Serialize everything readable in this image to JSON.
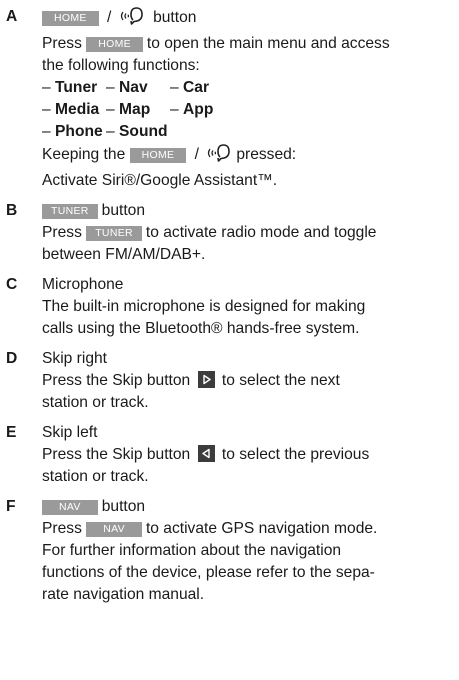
{
  "entries": {
    "A": {
      "letter": "A",
      "home_key": "HOME",
      "slash": "/",
      "title_suffix": "button",
      "line1_pre": "Press",
      "line1_post": "to open the main menu and access",
      "line2": "the following functions:",
      "functions": [
        {
          "dash": "–",
          "name": "Tuner"
        },
        {
          "dash": "–",
          "name": "Nav"
        },
        {
          "dash": "–",
          "name": "Car"
        },
        {
          "dash": "–",
          "name": "Media"
        },
        {
          "dash": "–",
          "name": "Map"
        },
        {
          "dash": "–",
          "name": "App"
        },
        {
          "dash": "–",
          "name": "Phone"
        },
        {
          "dash": "–",
          "name": "Sound"
        }
      ],
      "keeping_pre": "Keeping the",
      "keeping_post": "pressed:",
      "activate": "Activate Siri®/Google Assistant™."
    },
    "B": {
      "letter": "B",
      "key": "TUNER",
      "title_suffix": "button",
      "line1_pre": "Press",
      "line1_post": "to activate radio mode and toggle",
      "line2": "between FM/AM/DAB+."
    },
    "C": {
      "letter": "C",
      "title": "Microphone",
      "line1": "The built-in microphone is designed for making",
      "line2": "calls using the Bluetooth® hands-free system."
    },
    "D": {
      "letter": "D",
      "title": "Skip right",
      "line1_pre": "Press the Skip button",
      "line1_post": "to select the next",
      "line2": "station or track."
    },
    "E": {
      "letter": "E",
      "title": "Skip left",
      "line1_pre": "Press the Skip button",
      "line1_post": "to select the previous",
      "line2": "station or track."
    },
    "F": {
      "letter": "F",
      "key": "NAV",
      "title_suffix": "button",
      "line1_pre": "Press",
      "line1_post": "to activate GPS navigation mode.",
      "line2": "For further information about the navigation",
      "line3": "functions of the device, please refer to the sepa-",
      "line4": "rate navigation manual."
    }
  },
  "icons": {
    "voice": "voice-assistant-icon",
    "skip_right": "skip-right-icon",
    "skip_left": "skip-left-icon"
  }
}
